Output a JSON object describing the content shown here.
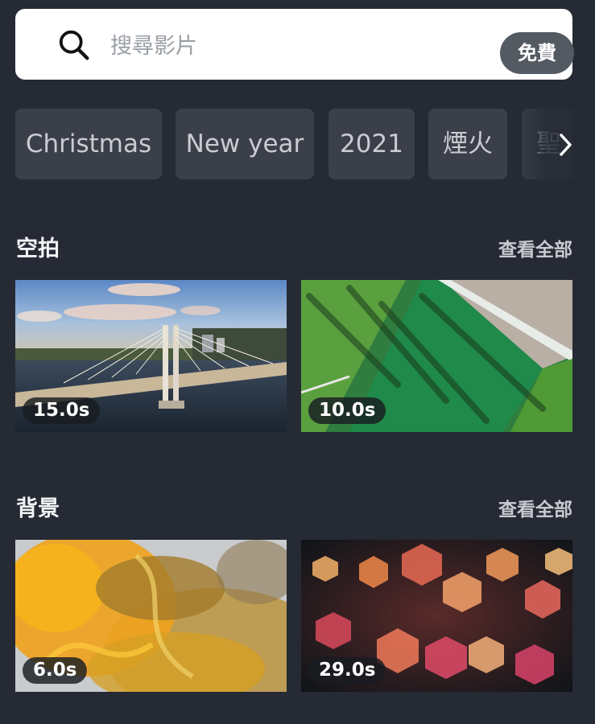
{
  "search": {
    "placeholder": "搜尋影片",
    "badge": "免費",
    "icon": "search-icon"
  },
  "chips": [
    "Christmas",
    "New year",
    "2021",
    "煙火",
    "聖"
  ],
  "chips_more_icon": "chevron-right-icon",
  "sections": [
    {
      "title": "空拍",
      "see_all": "查看全部",
      "videos": [
        {
          "duration": "15.0s"
        },
        {
          "duration": "10.0s"
        }
      ]
    },
    {
      "title": "背景",
      "see_all": "查看全部",
      "videos": [
        {
          "duration": "6.0s"
        },
        {
          "duration": "29.0s"
        }
      ]
    }
  ],
  "colors": {
    "background": "#252a34",
    "chip": "#3a3f49",
    "badge": "#545a62"
  }
}
